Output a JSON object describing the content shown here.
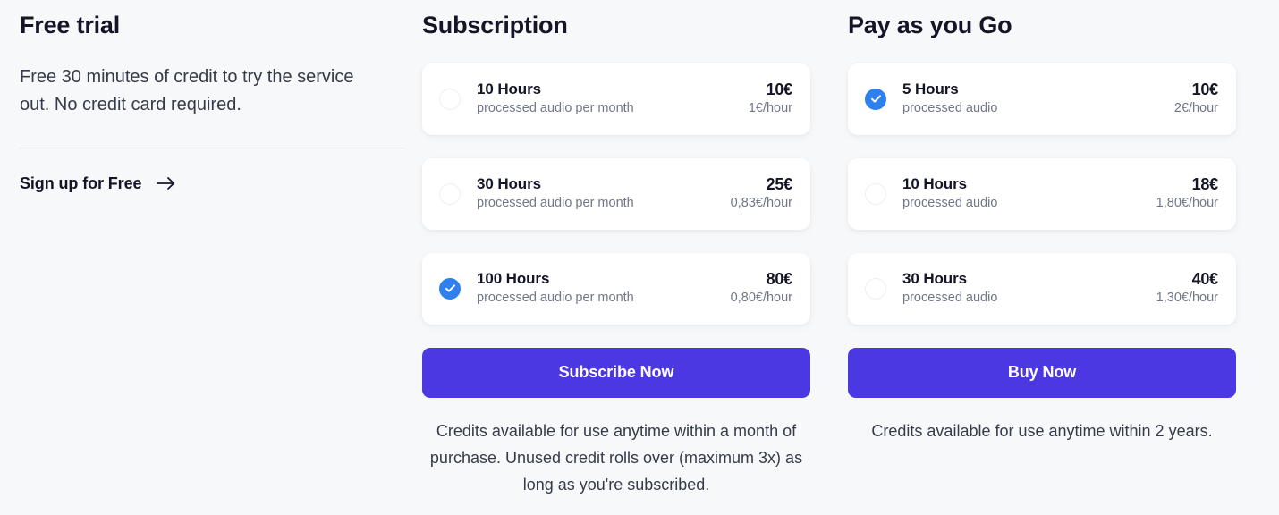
{
  "free_trial": {
    "heading": "Free trial",
    "description": "Free 30 minutes of credit to try the service out. No credit card required.",
    "cta_label": "Sign up for Free",
    "cta_icon": "arrow-right-icon"
  },
  "subscription": {
    "heading": "Subscription",
    "options": [
      {
        "title": "10 Hours",
        "subtitle": "processed audio per month",
        "price": "10€",
        "rate": "1€/hour",
        "selected": false
      },
      {
        "title": "30 Hours",
        "subtitle": "processed audio per month",
        "price": "25€",
        "rate": "0,83€/hour",
        "selected": false
      },
      {
        "title": "100 Hours",
        "subtitle": "processed audio per month",
        "price": "80€",
        "rate": "0,80€/hour",
        "selected": true
      }
    ],
    "cta_label": "Subscribe Now",
    "note": "Credits available for use anytime within a month of purchase. Unused credit rolls over (maximum 3x) as long as you're subscribed."
  },
  "pay_as_you_go": {
    "heading": "Pay as you Go",
    "options": [
      {
        "title": "5 Hours",
        "subtitle": "processed audio",
        "price": "10€",
        "rate": "2€/hour",
        "selected": true
      },
      {
        "title": "10 Hours",
        "subtitle": "processed audio",
        "price": "18€",
        "rate": "1,80€/hour",
        "selected": false
      },
      {
        "title": "30 Hours",
        "subtitle": "processed audio",
        "price": "40€",
        "rate": "1,30€/hour",
        "selected": false
      }
    ],
    "cta_label": "Buy Now",
    "note": "Credits available for use anytime within 2 years."
  },
  "colors": {
    "page_background": "#f7f8fa",
    "card_background": "#ffffff",
    "heading": "#151528",
    "body_text": "#353b48",
    "muted_text": "#707787",
    "radio_selected": "#2f80ed",
    "cta_background": "#4b38e3",
    "cta_text": "#ffffff",
    "divider": "#e7e9ee"
  }
}
